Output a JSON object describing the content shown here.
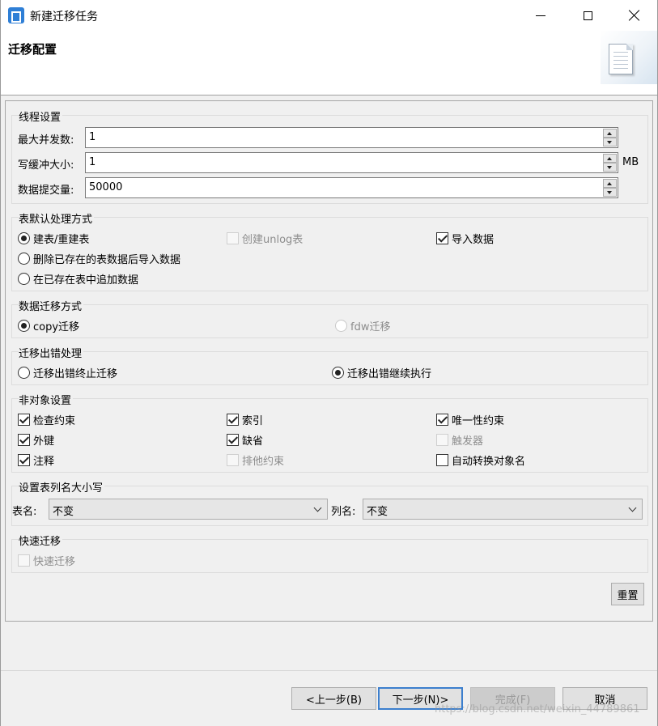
{
  "window": {
    "title": "新建迁移任务",
    "buttons": {
      "minimize": "minimize-icon",
      "maximize": "maximize-icon",
      "close": "close-icon"
    }
  },
  "header": {
    "title": "迁移配置",
    "icon": "document-icon"
  },
  "thread_settings": {
    "title": "线程设置",
    "max_concurrency": {
      "label": "最大并发数:",
      "value": "1"
    },
    "write_buffer": {
      "label": "写缓冲大小:",
      "value": "1",
      "unit": "MB"
    },
    "commit_size": {
      "label": "数据提交量:",
      "value": "50000"
    }
  },
  "table_default": {
    "title": "表默认处理方式",
    "options": [
      {
        "label": "建表/重建表",
        "checked": true
      },
      {
        "label": "删除已存在的表数据后导入数据",
        "checked": false
      },
      {
        "label": "在已存在表中追加数据",
        "checked": false
      }
    ],
    "create_unlog": {
      "label": "创建unlog表",
      "checked": false,
      "enabled": false
    },
    "import_data": {
      "label": "导入数据",
      "checked": true
    }
  },
  "migration_method": {
    "title": "数据迁移方式",
    "copy": {
      "label": "copy迁移",
      "checked": true
    },
    "fdw": {
      "label": "fdw迁移",
      "checked": false,
      "enabled": false
    }
  },
  "error_handling": {
    "title": "迁移出错处理",
    "stop": {
      "label": "迁移出错终止迁移",
      "checked": false
    },
    "continue": {
      "label": "迁移出错继续执行",
      "checked": true
    }
  },
  "non_object": {
    "title": "非对象设置",
    "items": [
      {
        "label": "检查约束",
        "checked": true,
        "enabled": true
      },
      {
        "label": "索引",
        "checked": true,
        "enabled": true
      },
      {
        "label": "唯一性约束",
        "checked": true,
        "enabled": true
      },
      {
        "label": "外键",
        "checked": true,
        "enabled": true
      },
      {
        "label": "缺省",
        "checked": true,
        "enabled": true
      },
      {
        "label": "触发器",
        "checked": false,
        "enabled": false
      },
      {
        "label": "注释",
        "checked": true,
        "enabled": true
      },
      {
        "label": "排他约束",
        "checked": false,
        "enabled": false
      },
      {
        "label": "自动转换对象名",
        "checked": false,
        "enabled": true
      }
    ]
  },
  "case_settings": {
    "title": "设置表列名大小写",
    "table_name": {
      "label": "表名:",
      "value": "不变"
    },
    "column_name": {
      "label": "列名:",
      "value": "不变"
    }
  },
  "fast_migration": {
    "title": "快速迁移",
    "option": {
      "label": "快速迁移",
      "checked": false,
      "enabled": false
    }
  },
  "buttons": {
    "reset": "重置",
    "prev": "<上一步(B)",
    "next": "下一步(N)>",
    "finish": "完成(F)",
    "cancel": "取消"
  },
  "watermark": "https://blog.csdn.net/weixin_44789861"
}
